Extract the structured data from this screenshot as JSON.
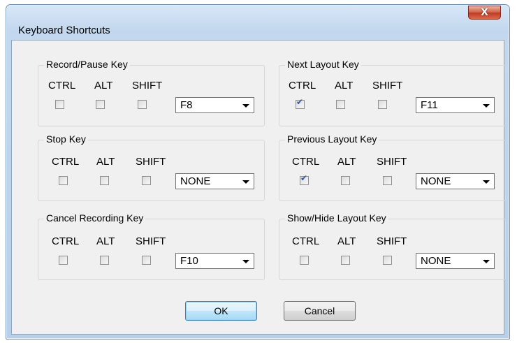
{
  "window": {
    "title": "Keyboard Shortcuts",
    "close_glyph": "X"
  },
  "modifier_labels": {
    "ctrl": "CTRL",
    "alt": "ALT",
    "shift": "SHIFT"
  },
  "groups": {
    "record_pause": {
      "label": "Record/Pause Key",
      "ctrl": false,
      "alt": false,
      "shift": false,
      "key": "F8"
    },
    "stop": {
      "label": "Stop Key",
      "ctrl": false,
      "alt": false,
      "shift": false,
      "key": "NONE"
    },
    "cancel_recording": {
      "label": "Cancel Recording Key",
      "ctrl": false,
      "alt": false,
      "shift": false,
      "key": "F10"
    },
    "next_layout": {
      "label": "Next Layout Key",
      "ctrl": true,
      "alt": false,
      "shift": false,
      "key": "F11"
    },
    "previous_layout": {
      "label": "Previous Layout Key",
      "ctrl": true,
      "alt": false,
      "shift": false,
      "key": "NONE"
    },
    "show_hide_layout": {
      "label": "Show/Hide Layout Key",
      "ctrl": false,
      "alt": false,
      "shift": false,
      "key": "NONE"
    }
  },
  "buttons": {
    "ok": "OK",
    "cancel": "Cancel"
  },
  "colors": {
    "title_bar": "#c3d8ee",
    "close_button": "#c13b22",
    "dialog_bg": "#f0f0f0",
    "check": "#31569f"
  }
}
